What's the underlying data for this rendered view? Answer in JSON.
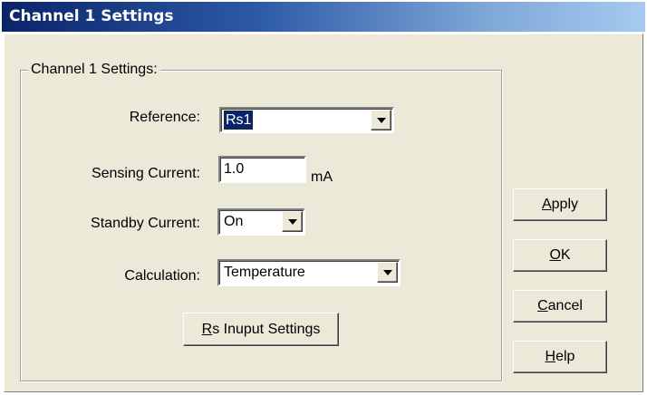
{
  "window": {
    "title": "Channel 1 Settings"
  },
  "group": {
    "legend": "Channel 1 Settings:"
  },
  "fields": {
    "reference": {
      "label": "Reference:",
      "value": "Rs1"
    },
    "sensing_current": {
      "label": "Sensing Current:",
      "value": "1.0",
      "unit": "mA"
    },
    "standby_current": {
      "label": "Standby Current:",
      "value": "On"
    },
    "calculation": {
      "label": "Calculation:",
      "value": "Temperature"
    }
  },
  "buttons": {
    "rs_input_settings": {
      "mnemonic": "R",
      "rest": "s Inuput Settings"
    },
    "apply": {
      "mnemonic": "A",
      "rest": "pply"
    },
    "ok": {
      "mnemonic": "O",
      "rest": "K"
    },
    "cancel": {
      "mnemonic": "C",
      "rest": "ancel"
    },
    "help": {
      "mnemonic": "H",
      "rest": "elp"
    }
  }
}
